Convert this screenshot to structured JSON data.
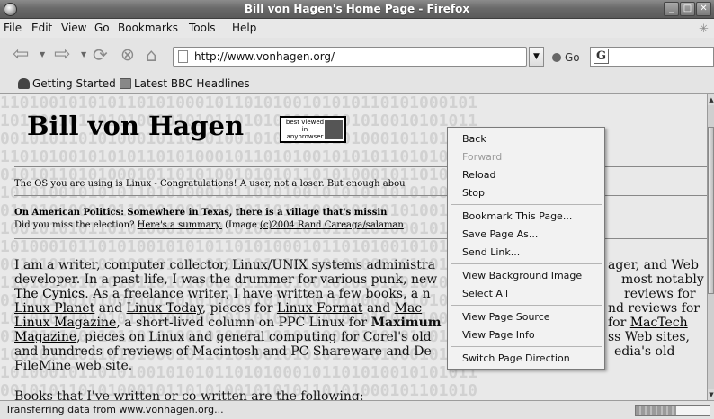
{
  "window": {
    "title": "Bill von Hagen's Home Page - Firefox"
  },
  "menubar": {
    "items": [
      {
        "label": "File"
      },
      {
        "label": "Edit"
      },
      {
        "label": "View"
      },
      {
        "label": "Go"
      },
      {
        "label": "Bookmarks"
      },
      {
        "label": "Tools"
      },
      {
        "label": "Help"
      }
    ]
  },
  "navbar": {
    "url": "http://www.vonhagen.org/",
    "go_label": "Go",
    "search_engine_glyph": "G"
  },
  "bookmarks": [
    {
      "label": "Getting Started"
    },
    {
      "label": "Latest BBC Headlines"
    }
  ],
  "page": {
    "title": "Bill von Hagen",
    "badge": "best viewed in anybrowser",
    "os_line": "The OS you are using is Linux - Congratulations! A user, not a loser. But enough abou",
    "politics_bold": "On American Politics: Somewhere in Texas, there is a village that's missin",
    "politics_line_prefix": "Did you miss the election? ",
    "politics_link": "Here's a summary.",
    "politics_line_mid": " (Image ",
    "politics_link2": "(c)2004 Rand Careaga/salaman",
    "p1": "I am a writer, computer collector, Linux/UNIX systems administra",
    "p2": "developer. In a past life, I was the drummer for various punk, new",
    "p3_link": "The Cynics",
    "p3_rest": ". As a freelance writer, I have written a few books, a n",
    "p4_link1": "Linux Planet",
    "p4_and": " and ",
    "p4_link2": "Linux Today",
    "p4_mid": ", pieces for ",
    "p4_link3": "Linux Format",
    "p4_and2": " and ",
    "p4_link4": "Mac ",
    "p5_link": "Linux Magazine",
    "p5_rest": ", a short-lived column on PPC Linux for ",
    "p5_bold": "Maximum",
    "p6_link": "Magazine",
    "p6_rest": ", pieces on Linux and general computing for Corel's old",
    "p7": "and hundreds of reviews of Macintosh and PC Shareware and De",
    "p8": "FileMine web site.",
    "p9": "Books that I've written or co-written are the following:",
    "right1": "ager, and Web",
    "right2": "most notably",
    "right3": "reviews for",
    "right4": "nd reviews for",
    "right5_pre": "for ",
    "right5_link": "MacTech",
    "right6": "ss Web sites,",
    "right7": "edia's old"
  },
  "context_menu": {
    "items": [
      {
        "label": "Back",
        "enabled": true
      },
      {
        "label": "Forward",
        "enabled": false
      },
      {
        "label": "Reload",
        "enabled": true
      },
      {
        "label": "Stop",
        "enabled": true
      },
      {
        "label": "Bookmark This Page...",
        "enabled": true
      },
      {
        "label": "Save Page As...",
        "enabled": true
      },
      {
        "label": "Send Link...",
        "enabled": true
      },
      {
        "label": "View Background Image",
        "enabled": true
      },
      {
        "label": "Select All",
        "enabled": true
      },
      {
        "label": "View Page Source",
        "enabled": true
      },
      {
        "label": "View Page Info",
        "enabled": true
      },
      {
        "label": "Switch Page Direction",
        "enabled": true
      }
    ]
  },
  "status": {
    "text": "Transferring data from www.vonhagen.org...",
    "progress": 0.55
  }
}
